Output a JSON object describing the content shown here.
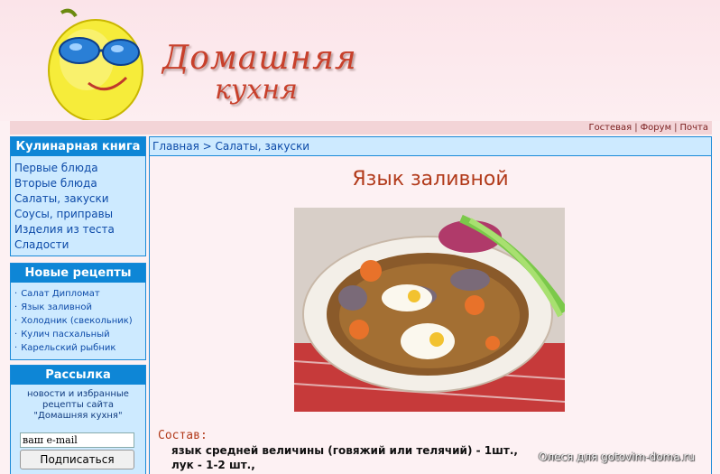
{
  "header": {
    "title_line1": "Домашняя",
    "title_line2": "кухня"
  },
  "topbar": {
    "links": [
      "Гостевая",
      "Форум",
      "Почта"
    ]
  },
  "sidebar": {
    "book": {
      "title": "Кулинарная книга",
      "items": [
        "Первые блюда",
        "Вторые блюда",
        "Салаты, закуски",
        "Соусы, приправы",
        "Изделия из теста",
        "Сладости"
      ]
    },
    "new_recipes": {
      "title": "Новые рецепты",
      "items": [
        "Салат Дипломат",
        "Язык заливной",
        "Холодник (свекольник)",
        "Кулич пасхальный",
        "Карельский рыбник"
      ]
    },
    "newsletter": {
      "title": "Рассылка",
      "description": "новости и избранные рецепты сайта \"Домашняя кухня\"",
      "email_value": "ваш e-mail",
      "subscribe_label": "Подписаться"
    }
  },
  "content": {
    "breadcrumb_home": "Главная",
    "breadcrumb_sep": " > ",
    "breadcrumb_section": "Салаты, закуски",
    "recipe_title": "Язык заливной",
    "ingredients_label": "Состав:",
    "ingredients": [
      "язык средней величины (говяжий или телячий) - 1шт.,",
      "лук - 1-2 шт.,"
    ],
    "watermark": "Олеся для gotovim-doma.ru"
  },
  "colors": {
    "accent_blue": "#0e86d6",
    "panel_bg": "#cdeaff",
    "title_red": "#b23b1b",
    "page_bg": "#fdf1f3"
  }
}
